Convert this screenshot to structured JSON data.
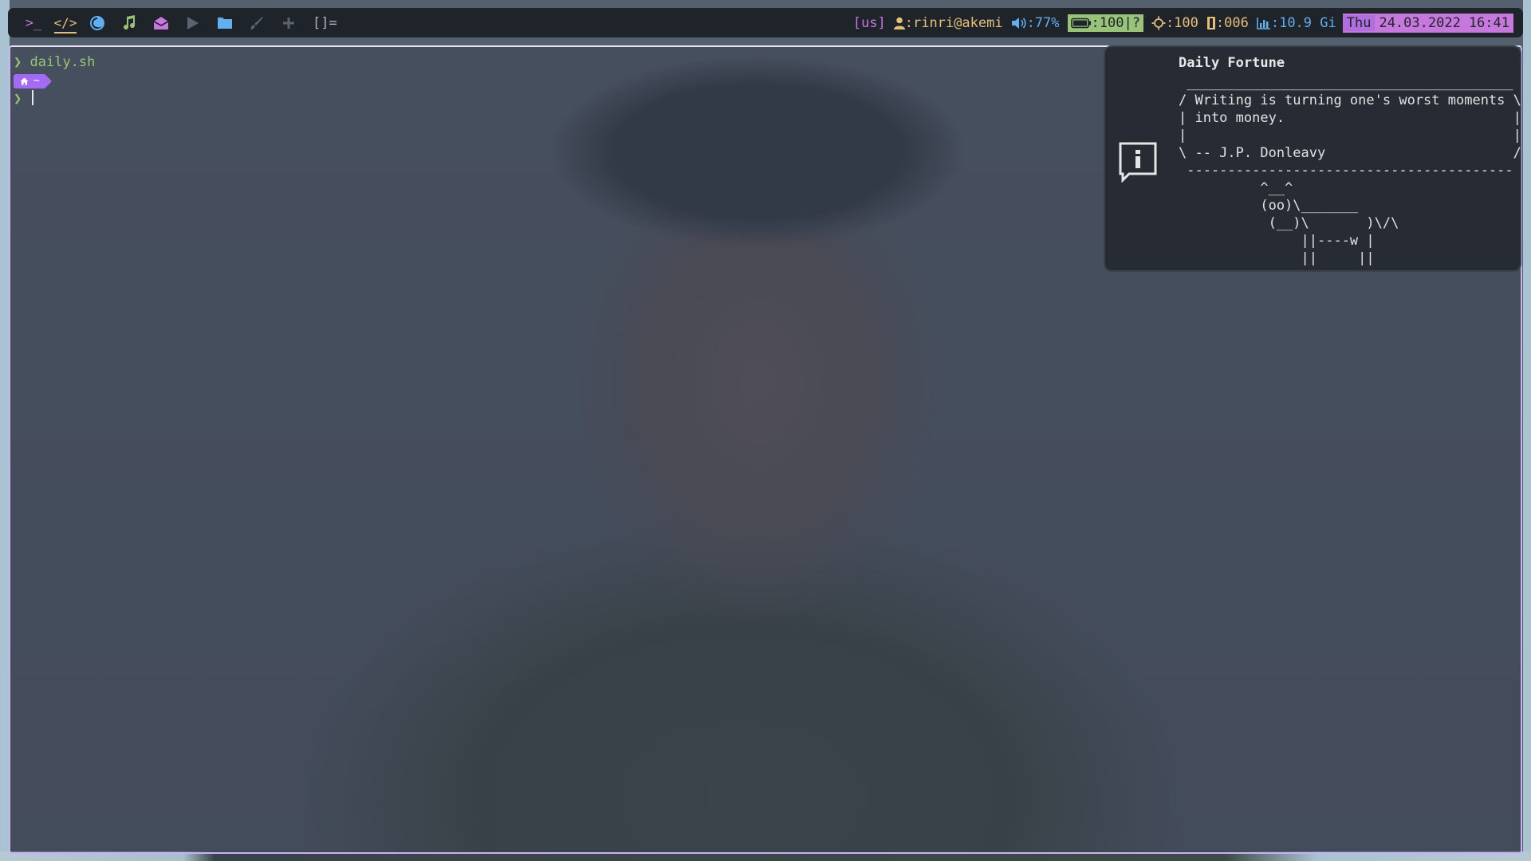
{
  "topbar": {
    "workspaces": [
      {
        "icon": "terminal-icon",
        "glyph": ">_",
        "color": "#c678dd",
        "active": false
      },
      {
        "icon": "code-icon",
        "glyph": "</>",
        "color": "#e5c07b",
        "active": true
      },
      {
        "icon": "firefox-icon",
        "color": "#61afef",
        "active": false
      },
      {
        "icon": "music-note-icon",
        "color": "#98c379",
        "active": false
      },
      {
        "icon": "mail-icon",
        "color": "#c678dd",
        "active": false
      },
      {
        "icon": "play-icon",
        "color": "#5c6370",
        "active": false
      },
      {
        "icon": "folder-icon",
        "color": "#61afef",
        "active": false
      },
      {
        "icon": "brush-icon",
        "color": "#5c6370",
        "active": false
      },
      {
        "icon": "plus-icon",
        "color": "#5c6370",
        "active": false
      }
    ],
    "layout_symbol": "[]=",
    "keyboard": "[us]",
    "user": ":rinri@akemi",
    "volume": ":77%",
    "battery": ":100|?",
    "brightness": ":100",
    "memory": ":006",
    "disk": ":10.9 Gi",
    "day": "Thu",
    "date": "24.03.2022",
    "time": "16:41"
  },
  "terminal": {
    "prompt_char": "❯",
    "command": "daily.sh",
    "path_badge": "~"
  },
  "notification": {
    "title": "Daily Fortune",
    "body": " ________________________________________\n/ Writing is turning one's worst moments \\\n| into money.                            |\n|                                        |\n\\ -- J.P. Donleavy                       /\n ----------------------------------------\n          ^__^\n          (oo)\\_______\n           (__)\\       )\\/\\\n               ||----w |\n               ||     ||"
  },
  "colors": {
    "accent": "#c678dd",
    "green": "#98c379",
    "yellow": "#e5c07b",
    "blue": "#61afef",
    "bar_bg": "#1f232a"
  }
}
